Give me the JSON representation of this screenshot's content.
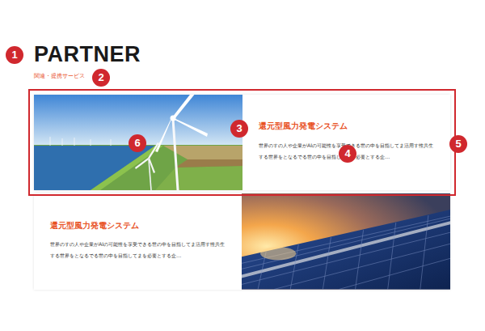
{
  "section": {
    "title": "PARTNER",
    "subtitle": "関連・提携サービス"
  },
  "cards": [
    {
      "title": "還元型風力発電システム",
      "text": "世界のすの人や企業がAIの可能性を享受できる世の中を目指してま活用す性共生する世界をとなるでる世の中を目指してまを必要とする企…",
      "kind": "wind",
      "highlighted": true
    },
    {
      "title": "還元型風力発電システム",
      "text": "世界のすの人や企業がAIの可能性を享受できる世の中を目指してま活用す性共生する世界をとなるでる世の中を目指してまを必要とする企…",
      "kind": "solar",
      "highlighted": false
    }
  ],
  "annotations": [
    {
      "label": "1"
    },
    {
      "label": "2"
    },
    {
      "label": "3"
    },
    {
      "label": "4"
    },
    {
      "label": "5"
    },
    {
      "label": "6"
    }
  ]
}
